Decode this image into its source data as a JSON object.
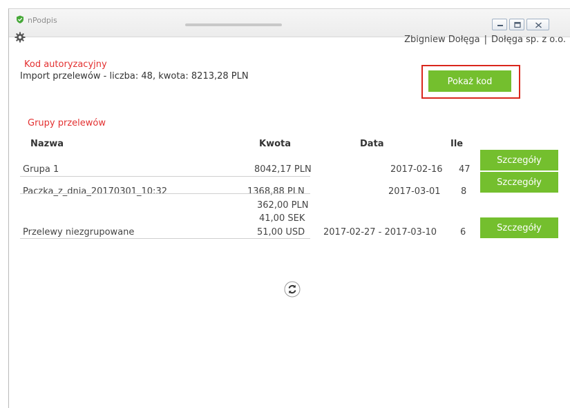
{
  "window": {
    "title": "nPodpis",
    "controls": [
      "minimize-icon",
      "maximize-icon",
      "close-icon"
    ]
  },
  "header": {
    "user_name": "Zbigniew Dołęga",
    "separator": "|",
    "company": "Dołęga sp. z o.o.",
    "settings_icon": "gear-icon"
  },
  "auth": {
    "heading": "Kod autoryzacyjny",
    "import_info": "Import przelewów - liczba: 48, kwota: 8213,28 PLN",
    "show_code_label": "Pokaż kod"
  },
  "groups": {
    "heading": "Grupy przelewów",
    "columns": {
      "name": "Nazwa",
      "amount": "Kwota",
      "date": "Data",
      "count": "Ile"
    },
    "rows": [
      {
        "name": "Grupa 1",
        "amounts": [
          "8042,17 PLN"
        ],
        "date": "2017-02-16",
        "count": "47",
        "action": "Szczegóły"
      },
      {
        "name": "Paczka_z_dnia_20170301_10:32",
        "amounts": [
          "1368,88 PLN"
        ],
        "date": "2017-03-01",
        "count": "8",
        "action": "Szczegóły"
      },
      {
        "name": "Przelewy niezgrupowane",
        "amounts": [
          "362,00 PLN",
          "41,00 SEK",
          "51,00 USD"
        ],
        "date": "2017-02-27 - 2017-03-10",
        "count": "6",
        "action": "Szczegóły"
      }
    ]
  },
  "refresh_icon": "refresh-icon",
  "colors": {
    "accent_green": "#74bf2e",
    "heading_red": "#e33030",
    "highlight_red": "#d9261c"
  }
}
